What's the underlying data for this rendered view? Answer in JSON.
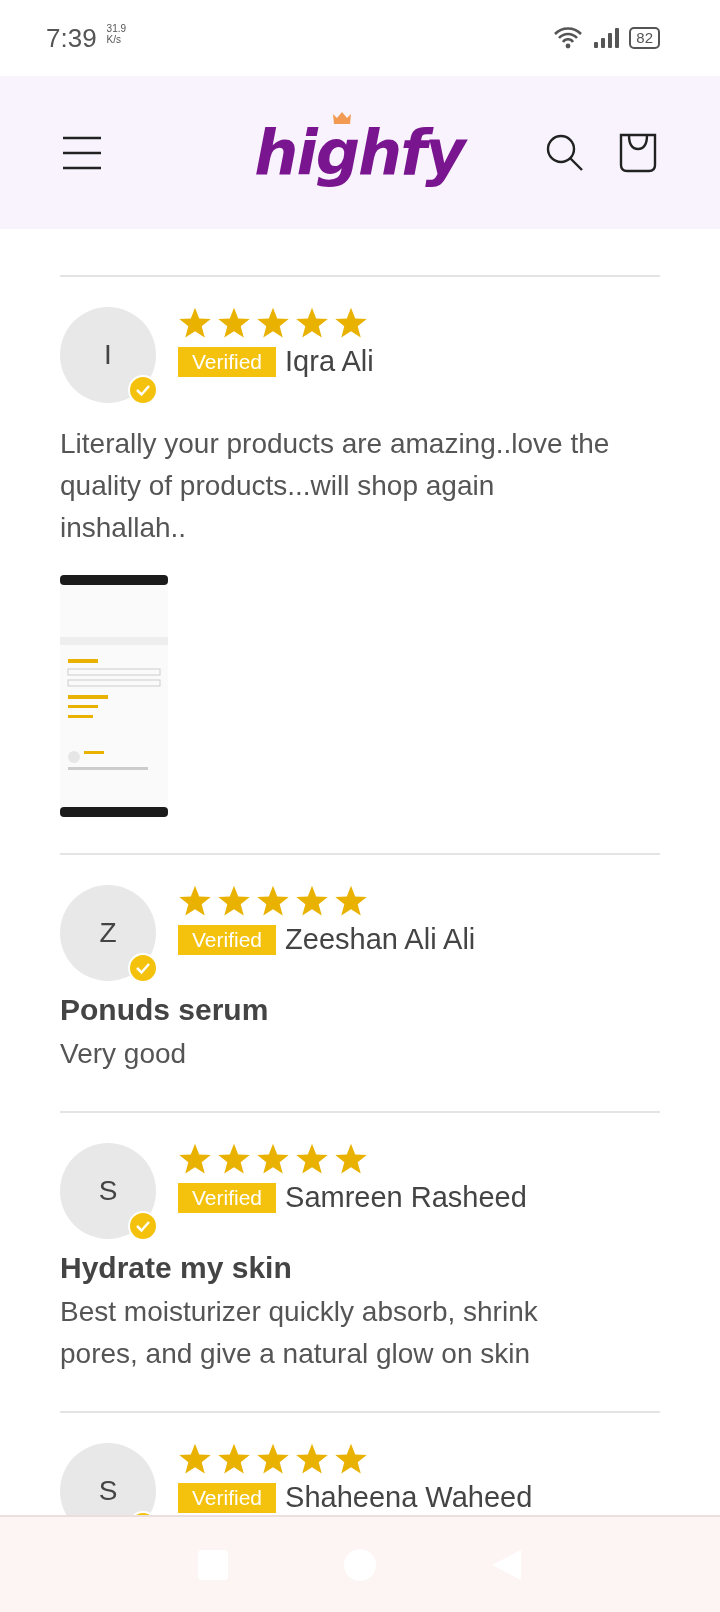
{
  "status_bar": {
    "time": "7:39",
    "speed_value": "31.9",
    "speed_unit": "K/s",
    "battery": "82"
  },
  "header": {
    "logo": "highfy"
  },
  "reviews": [
    {
      "initial": "I",
      "stars": 5,
      "verified": true,
      "badge": "Verified",
      "name": "Iqra Ali",
      "body": "Literally your products are amazing..love the quality of products...will shop again inshallah.."
    },
    {
      "initial": "Z",
      "stars": 5,
      "verified": true,
      "badge": "Verified",
      "name": "Zeeshan Ali Ali",
      "title": "Ponuds serum",
      "body": "Very good"
    },
    {
      "initial": "S",
      "stars": 5,
      "verified": true,
      "badge": "Verified",
      "name": "Samreen Rasheed",
      "title": "Hydrate my skin",
      "body": "Best moisturizer quickly absorb, shrink pores, and give a natural glow on skin"
    },
    {
      "initial": "S",
      "stars": 5,
      "verified": true,
      "badge": "Verified",
      "name": "Shaheena Waheed"
    }
  ]
}
